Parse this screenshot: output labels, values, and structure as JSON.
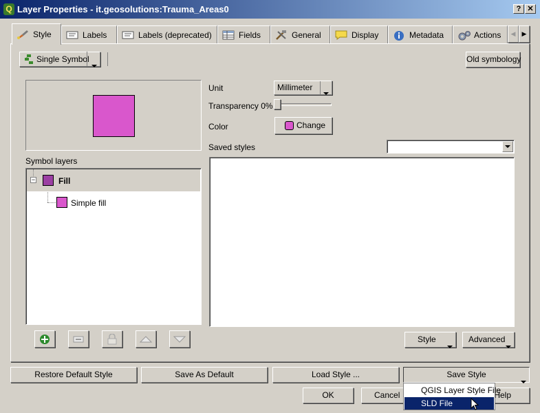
{
  "window": {
    "title": "Layer Properties - it.geosolutions:Trauma_Areas0",
    "help_glyph": "?",
    "close_glyph": "✕",
    "app_icon_glyph": "Q"
  },
  "tabs": [
    {
      "label": "Style",
      "icon": "paintbrush-icon",
      "active": true
    },
    {
      "label": "Labels",
      "icon": "labels-icon"
    },
    {
      "label": "Labels (deprecated)",
      "icon": "labels-deprecated-icon"
    },
    {
      "label": "Fields",
      "icon": "table-icon"
    },
    {
      "label": "General",
      "icon": "tools-icon"
    },
    {
      "label": "Display",
      "icon": "speech-bubble-icon"
    },
    {
      "label": "Metadata",
      "icon": "info-icon"
    },
    {
      "label": "Actions",
      "icon": "gears-icon"
    }
  ],
  "style": {
    "renderer_label": "Single Symbol",
    "old_symbology_label": "Old symbology",
    "unit_label": "Unit",
    "unit_value": "Millimeter",
    "transparency_label": "Transparency 0%",
    "transparency_value": 0,
    "color_label": "Color",
    "change_label": "Change",
    "fill_color": "#d957cc",
    "saved_styles_label": "Saved styles",
    "saved_styles_value": "",
    "symbol_layers_label": "Symbol layers",
    "tree": {
      "root_label": "Fill",
      "root_color": "#9b3fa3",
      "child_label": "Simple fill",
      "child_color": "#d957cc"
    },
    "style_button_label": "Style",
    "advanced_button_label": "Advanced"
  },
  "bottom": {
    "restore_default": "Restore Default Style",
    "save_as_default": "Save As Default",
    "load_style": "Load Style ...",
    "save_style": "Save Style",
    "ok": "OK",
    "cancel": "Cancel",
    "help": "Help"
  },
  "save_menu": {
    "items": [
      "QGIS Layer Style File",
      "SLD File"
    ],
    "highlighted_index": 1
  }
}
